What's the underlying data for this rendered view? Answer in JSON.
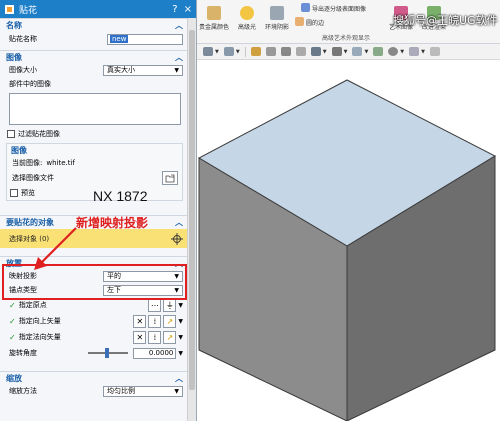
{
  "dialog": {
    "title": "贴花",
    "title_buttons": [
      "?",
      "×"
    ],
    "groups": {
      "name": {
        "header": "名称",
        "field_label": "贴花名称",
        "value": "new"
      },
      "image": {
        "header": "图像",
        "size_label": "图像大小",
        "size_value": "真实大小",
        "part_image_label": "部件中的图像",
        "filter_label": "过滤贴花图像",
        "sub_header": "图像",
        "current_image_label": "当前图像:",
        "current_image_value": "white.tif",
        "select_file_label": "选择图像文件",
        "preview_label": "预览"
      },
      "target": {
        "header": "要贴花的对象",
        "select_label": "选择对象 (0)"
      },
      "placement": {
        "header": "放置",
        "projection_label": "映射投影",
        "projection_value": "平的",
        "anchor_label": "锚点类型",
        "anchor_value": "左下",
        "origin_label": "指定原点",
        "up_vector_label": "指定向上矢量",
        "normal_vector_label": "指定法向矢量",
        "rotation_label": "旋转角度",
        "rotation_value": "0.0000"
      },
      "scale": {
        "header": "缩放",
        "method_label": "缩放方法",
        "method_value": "均匀比例"
      }
    }
  },
  "annotations": {
    "version": "NX 1872",
    "new_feature": "新增映射投影",
    "color": "#e02020"
  },
  "ribbon": {
    "items": [
      {
        "label": "贵金属颜色",
        "color": "#d9b36a"
      },
      {
        "label": "高级光",
        "color": "#f2c542"
      },
      {
        "label": "环境阴影",
        "color": "#9aa6b2"
      },
      {
        "label": "导出逐分级表面图像",
        "color": "#6b8fd6"
      },
      {
        "label": "圆的边",
        "color": "#e8b070"
      },
      {
        "label": "艺术图像",
        "color": "#d05a8a"
      },
      {
        "label": "改进渲染",
        "color": "#7ab06a"
      },
      {
        "label": "部件中的材料",
        "color": "#c44"
      }
    ],
    "group_label": "高级艺术外观显示"
  },
  "viewport": {
    "watermark": "搜狐号@王皖UG软件",
    "cube_colors": {
      "top": "#c5d6e6",
      "left": "#8c8c8c",
      "right": "#6e6e6e",
      "edge": "#3a3a3a"
    }
  }
}
